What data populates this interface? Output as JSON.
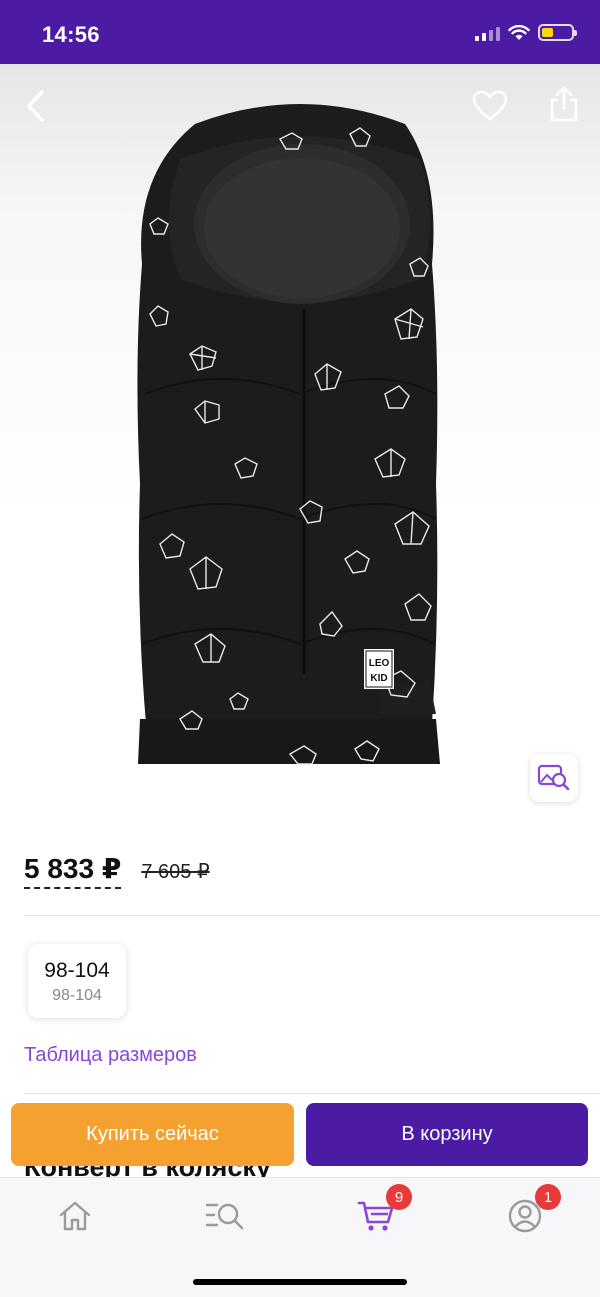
{
  "status_bar": {
    "time": "14:56"
  },
  "product": {
    "brand_label_line1": "LEO",
    "brand_label_line2": "KID",
    "price_current": "5 833 ₽",
    "price_old": "7 605 ₽",
    "size": {
      "selected": "98-104",
      "sub": "98-104"
    },
    "size_table_link": "Таблица размеров",
    "title": "Конверт в коляску"
  },
  "actions": {
    "buy_now": "Купить сейчас",
    "add_to_cart": "В корзину"
  },
  "bottom_nav": {
    "items": [
      {
        "icon": "home-icon"
      },
      {
        "icon": "catalog-search-icon"
      },
      {
        "icon": "cart-icon",
        "badge": "9"
      },
      {
        "icon": "profile-icon",
        "badge": "1"
      }
    ]
  },
  "colors": {
    "brand_purple": "#4b1ca3",
    "accent_orange": "#f4a130",
    "link_purple": "#8a46d6",
    "badge_red": "#e83a3a"
  }
}
